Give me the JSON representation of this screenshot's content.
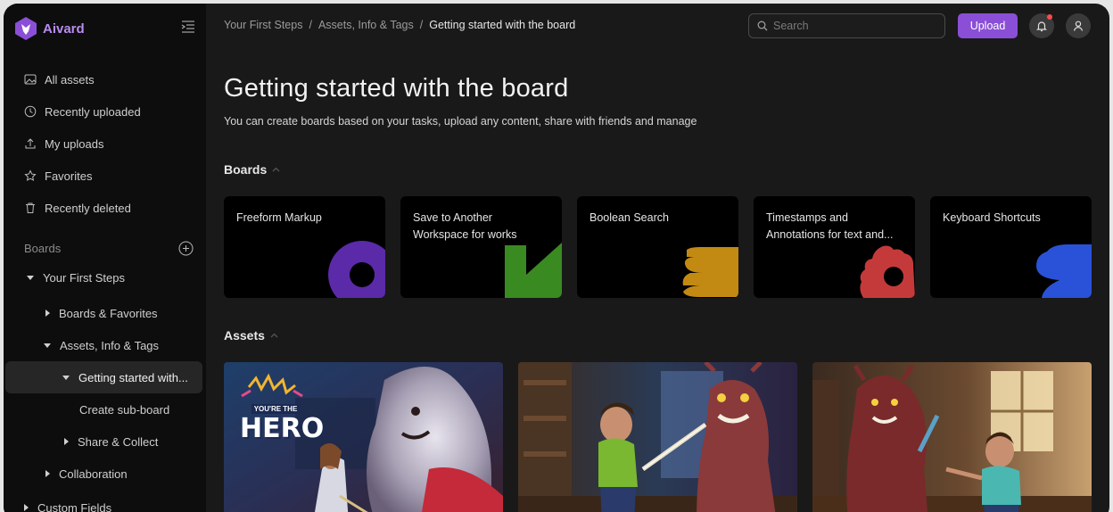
{
  "app": {
    "name": "Aivard"
  },
  "sidebar": {
    "nav": [
      {
        "label": "All assets",
        "icon": "image-icon"
      },
      {
        "label": "Recently uploaded",
        "icon": "clock-icon"
      },
      {
        "label": "My uploads",
        "icon": "upload-icon"
      },
      {
        "label": "Favorites",
        "icon": "star-icon"
      },
      {
        "label": "Recently deleted",
        "icon": "trash-icon"
      }
    ],
    "boards_heading": "Boards",
    "tree": [
      {
        "label": "Your First Steps"
      },
      {
        "label": "Boards & Favorites"
      },
      {
        "label": "Assets, Info & Tags"
      },
      {
        "label": "Getting started with..."
      },
      {
        "label": "Create sub-board"
      },
      {
        "label": "Share & Collect"
      },
      {
        "label": "Collaboration"
      },
      {
        "label": "Custom Fields"
      }
    ]
  },
  "breadcrumb": [
    "Your First Steps",
    "Assets, Info & Tags",
    "Getting started with the board"
  ],
  "search": {
    "placeholder": "Search"
  },
  "header": {
    "upload_label": "Upload"
  },
  "page": {
    "title": "Getting started with the board",
    "description": "You can create boards based on your tasks, upload any content, share with friends and manage"
  },
  "boards_section": {
    "label": "Boards",
    "cards": [
      {
        "title": "Freeform Markup",
        "accent": "#5a2aa8"
      },
      {
        "title": "Save to Another Workspace for works",
        "accent": "#3a8a22"
      },
      {
        "title": "Boolean Search",
        "accent": "#c28a12"
      },
      {
        "title": "Timestamps and Annotations for text and...",
        "accent": "#c43a3a"
      },
      {
        "title": "Keyboard Shortcuts",
        "accent": "#2a52d8"
      }
    ]
  },
  "assets_section": {
    "label": "Assets",
    "items": [
      {
        "badge_line1": "YOU'RE THE",
        "badge_line2": "HERO"
      },
      {},
      {}
    ]
  }
}
